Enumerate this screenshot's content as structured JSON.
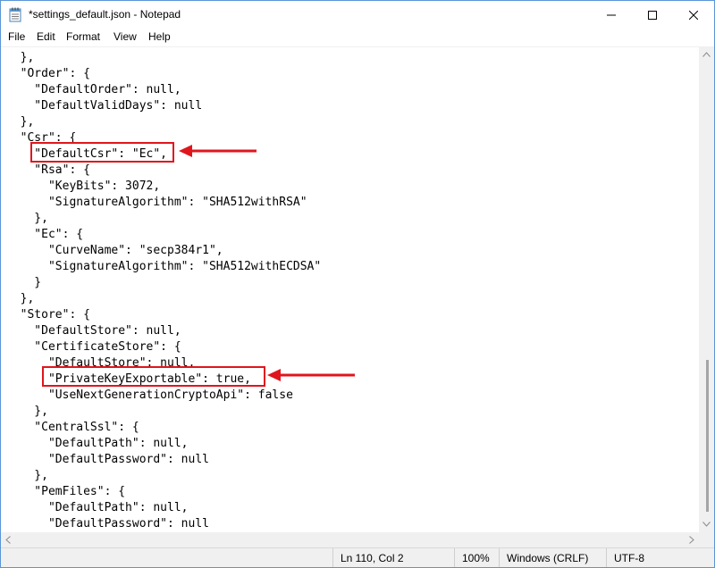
{
  "window": {
    "title": "*settings_default.json - Notepad"
  },
  "menu": {
    "items": [
      "File",
      "Edit",
      "Format",
      "View",
      "Help"
    ]
  },
  "editor": {
    "lines": [
      "  },",
      "  \"Order\": {",
      "    \"DefaultOrder\": null,",
      "    \"DefaultValidDays\": null",
      "  },",
      "  \"Csr\": {",
      "    \"DefaultCsr\": \"Ec\",",
      "    \"Rsa\": {",
      "      \"KeyBits\": 3072,",
      "      \"SignatureAlgorithm\": \"SHA512withRSA\"",
      "    },",
      "    \"Ec\": {",
      "      \"CurveName\": \"secp384r1\",",
      "      \"SignatureAlgorithm\": \"SHA512withECDSA\"",
      "    }",
      "  },",
      "  \"Store\": {",
      "    \"DefaultStore\": null,",
      "    \"CertificateStore\": {",
      "      \"DefaultStore\": null,",
      "      \"PrivateKeyExportable\": true,",
      "      \"UseNextGenerationCryptoApi\": false",
      "    },",
      "    \"CentralSsl\": {",
      "      \"DefaultPath\": null,",
      "      \"DefaultPassword\": null",
      "    },",
      "    \"PemFiles\": {",
      "      \"DefaultPath\": null,",
      "      \"DefaultPassword\": null",
      "    }"
    ]
  },
  "status": {
    "position": "Ln 110, Col 2",
    "zoom": "100%",
    "line_ending": "Windows (CRLF)",
    "encoding": "UTF-8"
  },
  "annotations": {
    "highlight_color": "#e0161d"
  }
}
